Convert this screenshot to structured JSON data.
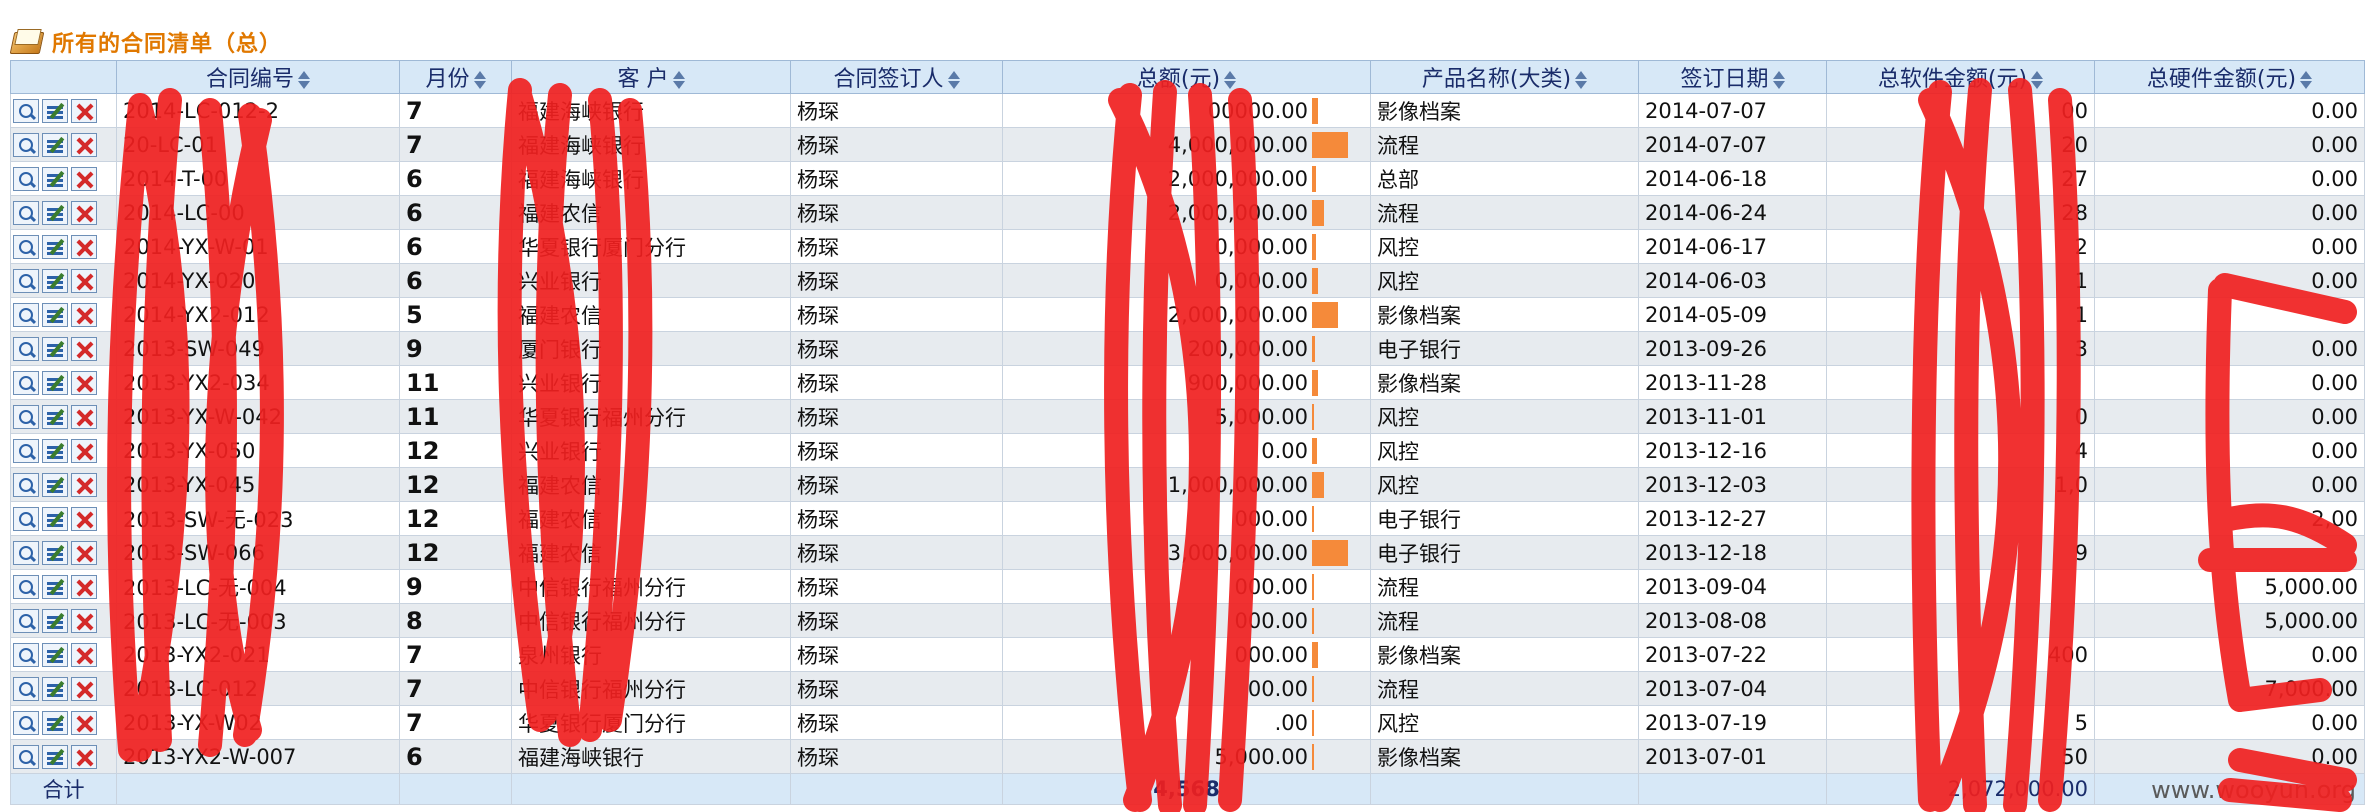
{
  "title": "所有的合同清单（总）",
  "colors": {
    "title": "#e07800",
    "header_bg": "#d7e8f7",
    "bar": "#f58a3a",
    "redaction": "#f02020"
  },
  "columns": [
    {
      "key": "ops",
      "label": ""
    },
    {
      "key": "contract_no",
      "label": "合同编号"
    },
    {
      "key": "month",
      "label": "月份"
    },
    {
      "key": "client",
      "label": "客 户"
    },
    {
      "key": "signer",
      "label": "合同签订人"
    },
    {
      "key": "total",
      "label": "总额(元)"
    },
    {
      "key": "product",
      "label": "产品名称(大类)"
    },
    {
      "key": "date",
      "label": "签订日期"
    },
    {
      "key": "software",
      "label": "总软件金额(元)"
    },
    {
      "key": "hardware",
      "label": "总硬件金额(元)"
    }
  ],
  "rows": [
    {
      "contract_no": "2014-LC-012-2",
      "month": "7",
      "client": "福建海峡银行",
      "signer": "杨琛",
      "total": "00000.00",
      "bar": 0.12,
      "product": "影像档案",
      "date": "2014-07-07",
      "software": "00",
      "hardware": "0.00"
    },
    {
      "contract_no": "20-LC-01",
      "month": "7",
      "client": "福建海峡银行",
      "signer": "杨琛",
      "total": "4,000,000.00",
      "bar": 0.75,
      "product": "流程",
      "date": "2014-07-07",
      "software": "20",
      "hardware": "0.00"
    },
    {
      "contract_no": "2014-T-00",
      "month": "6",
      "client": "福建海峡银行",
      "signer": "杨琛",
      "total": "2,000,000.00",
      "bar": 0.08,
      "product": "总部",
      "date": "2014-06-18",
      "software": "27",
      "hardware": "0.00"
    },
    {
      "contract_no": "2014-LC-00",
      "month": "6",
      "client": "福建农信",
      "signer": "杨琛",
      "total": "2,000,000.00",
      "bar": 0.25,
      "product": "流程",
      "date": "2014-06-24",
      "software": "28",
      "hardware": "0.00"
    },
    {
      "contract_no": "2014-YX-W-01",
      "month": "6",
      "client": "华夏银行厦门分行",
      "signer": "杨琛",
      "total": "0,000.00",
      "bar": 0.08,
      "product": "风控",
      "date": "2014-06-17",
      "software": "2",
      "hardware": "0.00"
    },
    {
      "contract_no": "2014-YX-020",
      "month": "6",
      "client": "兴业银行",
      "signer": "杨琛",
      "total": "0,000.00",
      "bar": 0.12,
      "product": "风控",
      "date": "2014-06-03",
      "software": "1",
      "hardware": "0.00"
    },
    {
      "contract_no": "2014-YX2-012",
      "month": "5",
      "client": "福建农信",
      "signer": "杨琛",
      "total": "2,000,000.00",
      "bar": 0.55,
      "product": "影像档案",
      "date": "2014-05-09",
      "software": "1",
      "hardware": ""
    },
    {
      "contract_no": "2013-SW-049",
      "month": "9",
      "client": "厦门银行",
      "signer": "杨琛",
      "total": "200,000.00",
      "bar": 0.06,
      "product": "电子银行",
      "date": "2013-09-26",
      "software": "3",
      "hardware": "0.00"
    },
    {
      "contract_no": "2013-YX2-034",
      "month": "11",
      "client": "兴业银行",
      "signer": "杨琛",
      "total": "900,000.00",
      "bar": 0.12,
      "product": "影像档案",
      "date": "2013-11-28",
      "software": "",
      "hardware": "0.00"
    },
    {
      "contract_no": "2013-YX-W-042",
      "month": "11",
      "client": "华夏银行福州分行",
      "signer": "杨琛",
      "total": "5,000.00",
      "bar": 0.04,
      "product": "风控",
      "date": "2013-11-01",
      "software": "0",
      "hardware": "0.00"
    },
    {
      "contract_no": "2013-YX-050",
      "month": "12",
      "client": "兴业银行",
      "signer": "杨琛",
      "total": "0.00",
      "bar": 0.1,
      "product": "风控",
      "date": "2013-12-16",
      "software": "4",
      "hardware": "0.00"
    },
    {
      "contract_no": "2013-YX-045",
      "month": "12",
      "client": "福建农信",
      "signer": "杨琛",
      "total": "1,000,000.00",
      "bar": 0.25,
      "product": "风控",
      "date": "2013-12-03",
      "software": "1,0",
      "hardware": "0.00"
    },
    {
      "contract_no": "2013-SW-无-023",
      "month": "12",
      "client": "福建农信",
      "signer": "杨琛",
      "total": "000.00",
      "bar": 0.04,
      "product": "电子银行",
      "date": "2013-12-27",
      "software": "",
      "hardware": "2,00"
    },
    {
      "contract_no": "2013-SW-066",
      "month": "12",
      "client": "福建农信",
      "signer": "杨琛",
      "total": "3,000,000.00",
      "bar": 0.75,
      "product": "电子银行",
      "date": "2013-12-18",
      "software": "9",
      "hardware": ""
    },
    {
      "contract_no": "2013-LC-无-004",
      "month": "9",
      "client": "中信银行福州分行",
      "signer": "杨琛",
      "total": "000.00",
      "bar": 0.04,
      "product": "流程",
      "date": "2013-09-04",
      "software": "",
      "hardware": "5,000.00"
    },
    {
      "contract_no": "2013-LC-无-003",
      "month": "8",
      "client": "中信银行福州分行",
      "signer": "杨琛",
      "total": "000.00",
      "bar": 0.04,
      "product": "流程",
      "date": "2013-08-08",
      "software": "",
      "hardware": "5,000.00"
    },
    {
      "contract_no": "2013-YX2-021",
      "month": "7",
      "client": "泉州银行",
      "signer": "杨琛",
      "total": "000.00",
      "bar": 0.12,
      "product": "影像档案",
      "date": "2013-07-22",
      "software": "400",
      "hardware": "0.00"
    },
    {
      "contract_no": "2013-LC-012",
      "month": "7",
      "client": "中信银行福州分行",
      "signer": "杨琛",
      "total": "00.00",
      "bar": 0.04,
      "product": "流程",
      "date": "2013-07-04",
      "software": "",
      "hardware": "7,000.00"
    },
    {
      "contract_no": "2013-YX-W02",
      "month": "7",
      "client": "华夏银行厦门分行",
      "signer": "杨琛",
      "total": ".00",
      "bar": 0.04,
      "product": "风控",
      "date": "2013-07-19",
      "software": "5",
      "hardware": "0.00"
    },
    {
      "contract_no": "2013-YX2-W-007",
      "month": "6",
      "client": "福建海峡银行",
      "signer": "杨琛",
      "total": "5,000.00",
      "bar": 0.04,
      "product": "影像档案",
      "date": "2013-07-01",
      "software": "50",
      "hardware": "0.00"
    }
  ],
  "totals": {
    "label": "合计",
    "total": "4,568",
    "software": "2,072,000.00",
    "hardware": ""
  },
  "watermark": "www.wooyun.org",
  "icons": [
    "view-icon",
    "edit-icon",
    "delete-icon",
    "book-icon",
    "sort-icon"
  ]
}
